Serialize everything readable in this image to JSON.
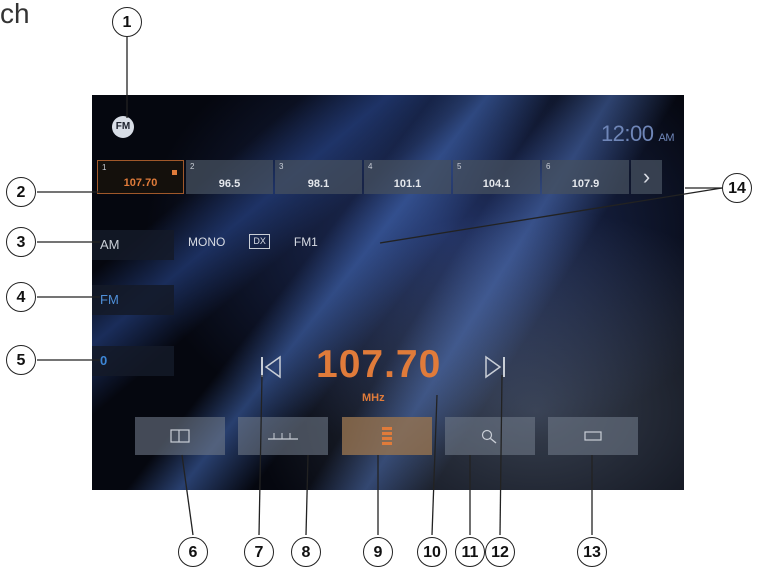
{
  "header_fragment": "ch",
  "screen": {
    "clock": {
      "time": "12:00",
      "ampm": "AM"
    },
    "radio_icon": "FM",
    "presets": [
      {
        "num": "1",
        "freq": "107.70",
        "active": true
      },
      {
        "num": "2",
        "freq": "96.5",
        "active": false
      },
      {
        "num": "3",
        "freq": "98.1",
        "active": false
      },
      {
        "num": "4",
        "freq": "101.1",
        "active": false
      },
      {
        "num": "5",
        "freq": "104.1",
        "active": false
      },
      {
        "num": "6",
        "freq": "107.9",
        "active": false
      }
    ],
    "preset_next": "›",
    "band_buttons": {
      "am": "AM",
      "fm": "FM",
      "scan": "0"
    },
    "status": {
      "mono": "MONO",
      "dx": "DX",
      "band": "FM1"
    },
    "frequency": {
      "value": "107.70",
      "unit": "MHz"
    },
    "colors": {
      "accent": "#e07b3a",
      "blue": "#3d86d6"
    }
  },
  "callouts": [
    "1",
    "2",
    "3",
    "4",
    "5",
    "6",
    "7",
    "8",
    "9",
    "10",
    "11",
    "12",
    "13",
    "14"
  ]
}
